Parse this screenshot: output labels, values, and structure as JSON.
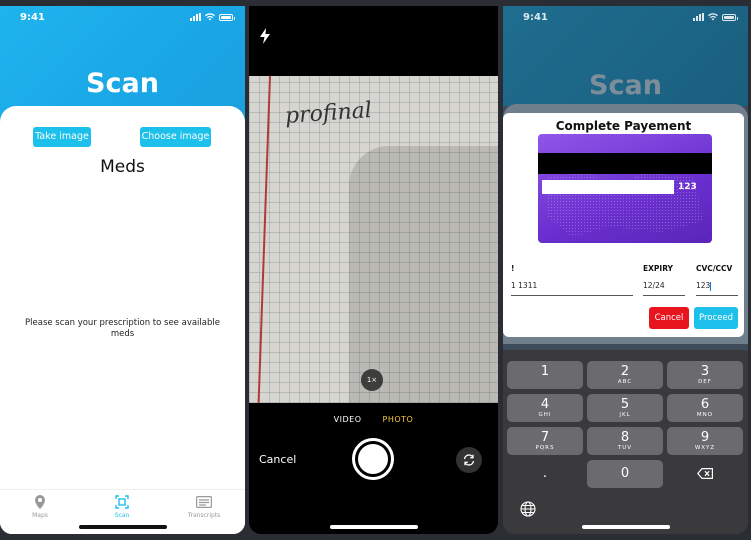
{
  "phone1": {
    "status_time": "9:41",
    "title": "Scan",
    "take_image_label": "Take image",
    "choose_image_label": "Choose image",
    "section_heading": "Meds",
    "hint_text": "Please scan your prescription to see available meds",
    "tabs": [
      {
        "label": "Maps",
        "icon": "map-pin-icon"
      },
      {
        "label": "Scan",
        "icon": "scan-icon"
      },
      {
        "label": "Transcripts",
        "icon": "document-icon"
      }
    ],
    "accent_color": "#1cc0ea"
  },
  "phone2": {
    "handwriting": "profinal",
    "zoom_label": "1×",
    "modes": [
      "VIDEO",
      "PHOTO"
    ],
    "active_mode": "PHOTO",
    "cancel_label": "Cancel"
  },
  "phone3": {
    "status_time": "9:41",
    "title": "Scan",
    "modal_title": "Complete Payement",
    "card_cvc": "123",
    "fields": {
      "number_label": "!",
      "number_value": "1 1311",
      "expiry_label": "EXPIRY",
      "expiry_value": "12/24",
      "cvc_label": "CVC/CCV",
      "cvc_value": "123"
    },
    "cancel_label": "Cancel",
    "proceed_label": "Proceed",
    "cancel_color": "#e8141e",
    "proceed_color": "#1cc0ea",
    "keypad": [
      {
        "n": "1",
        "l": ""
      },
      {
        "n": "2",
        "l": "ABC"
      },
      {
        "n": "3",
        "l": "DEF"
      },
      {
        "n": "4",
        "l": "GHI"
      },
      {
        "n": "5",
        "l": "JKL"
      },
      {
        "n": "6",
        "l": "MNO"
      },
      {
        "n": "7",
        "l": "PQRS"
      },
      {
        "n": "8",
        "l": "TUV"
      },
      {
        "n": "9",
        "l": "WXYZ"
      },
      {
        "n": ".",
        "l": ""
      },
      {
        "n": "0",
        "l": ""
      }
    ]
  }
}
